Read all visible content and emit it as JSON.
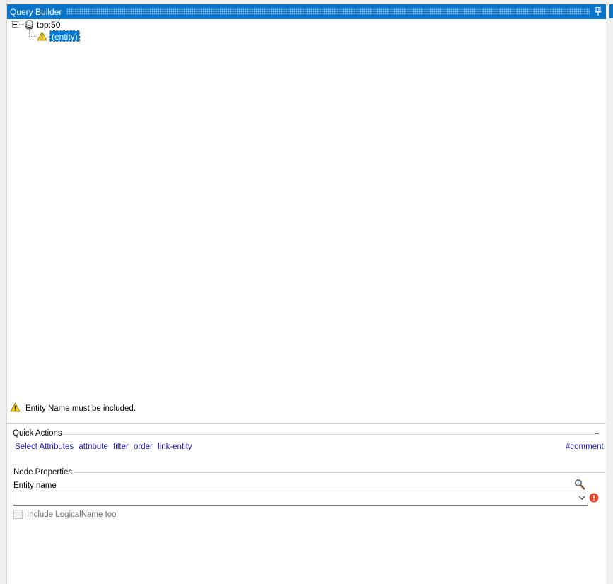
{
  "window": {
    "title": "Query Builder"
  },
  "tree": {
    "root": {
      "label": "top:50",
      "icon": "database-icon"
    },
    "child": {
      "label": "(entity)",
      "icon": "warning-icon",
      "selected": true
    }
  },
  "validation": {
    "message": "Entity Name must be included.",
    "icon": "warning-icon"
  },
  "quick_actions": {
    "title": "Quick Actions",
    "collapse_symbol": "–",
    "links": [
      "Select Attributes",
      "attribute",
      "filter",
      "order",
      "link-entity"
    ],
    "comment_link": "#comment"
  },
  "node_properties": {
    "title": "Node Properties",
    "entity_name_label": "Entity name",
    "entity_name_value": "",
    "include_logicalname": {
      "label": "Include LogicalName too",
      "checked": false,
      "enabled": false
    }
  },
  "colors": {
    "accent": "#0a74c9",
    "selection": "#0078d7",
    "link": "#1a1ab8",
    "warning": "#f7d21e",
    "error": "#e0442b"
  }
}
